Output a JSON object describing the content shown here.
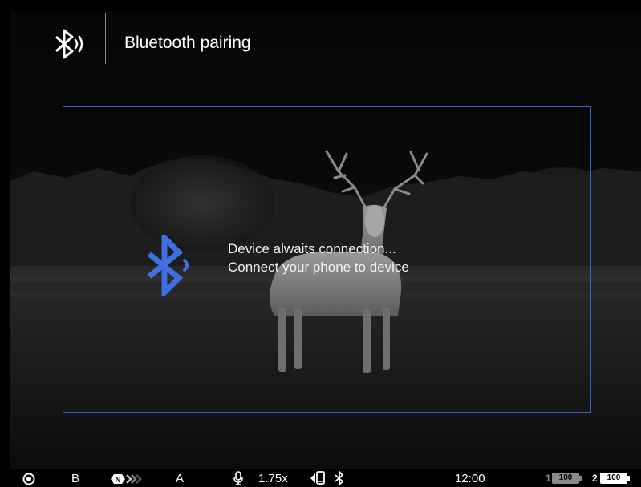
{
  "header": {
    "icon": "bluetooth-pairing-icon",
    "title": "Bluetooth pairing"
  },
  "dialog": {
    "icon": "bluetooth-icon",
    "line1": "Device alwaits connection...",
    "line2": "Connect your phone to device",
    "border_color": "#3a5ec8",
    "icon_color": "#3f6fe0"
  },
  "status_bar": {
    "record_icon": "record-icon",
    "mode_b": "B",
    "nfc_icon": "n-badge-icon",
    "mode_a": "A",
    "mic_icon": "microphone-icon",
    "zoom": "1.75x",
    "phone_bt_icon": "phone-bluetooth-icon",
    "bluetooth_icon": "bluetooth-icon",
    "time": "12:00",
    "battery1_label": "1",
    "battery1_value": "100",
    "battery2_label": "2",
    "battery2_value": "100"
  }
}
